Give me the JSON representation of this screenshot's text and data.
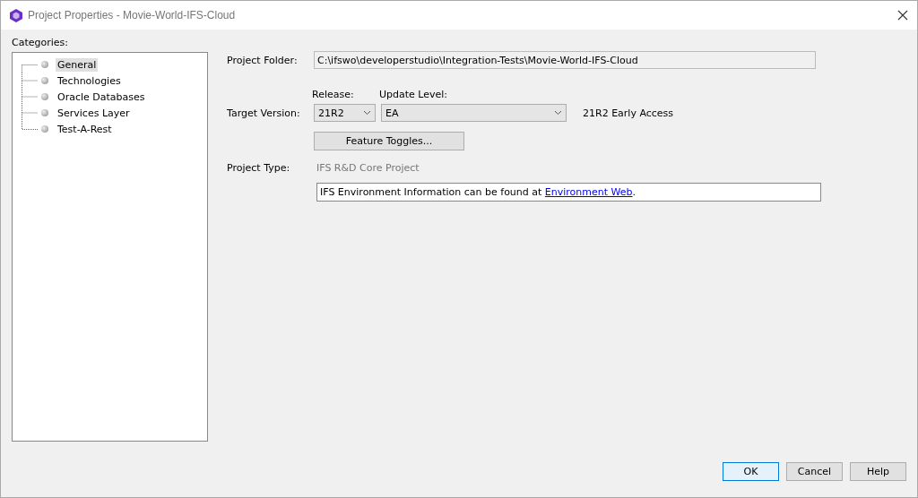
{
  "window": {
    "title": "Project Properties - Movie-World-IFS-Cloud"
  },
  "categories": {
    "label": "Categories:",
    "items": [
      {
        "label": "General",
        "selected": true
      },
      {
        "label": "Technologies",
        "selected": false
      },
      {
        "label": "Oracle Databases",
        "selected": false
      },
      {
        "label": "Services Layer",
        "selected": false
      },
      {
        "label": "Test-A-Rest",
        "selected": false
      }
    ]
  },
  "general": {
    "project_folder": {
      "label": "Project Folder:",
      "value": "C:\\ifswo\\developerstudio\\Integration-Tests\\Movie-World-IFS-Cloud"
    },
    "release": {
      "label": "Release:",
      "value": "21R2"
    },
    "update_level": {
      "label": "Update Level:",
      "value": "EA"
    },
    "target_version": {
      "label": "Target Version:",
      "description": "21R2 Early Access"
    },
    "feature_toggles_button": "Feature Toggles...",
    "project_type": {
      "label": "Project Type:",
      "value": "IFS R&D Core Project"
    },
    "info": {
      "text": "IFS Environment Information can be found at ",
      "link": "Environment Web",
      "after": "."
    }
  },
  "buttons": [
    {
      "label": "OK",
      "default": true
    },
    {
      "label": "Cancel",
      "default": false
    },
    {
      "label": "Help",
      "default": false
    }
  ]
}
